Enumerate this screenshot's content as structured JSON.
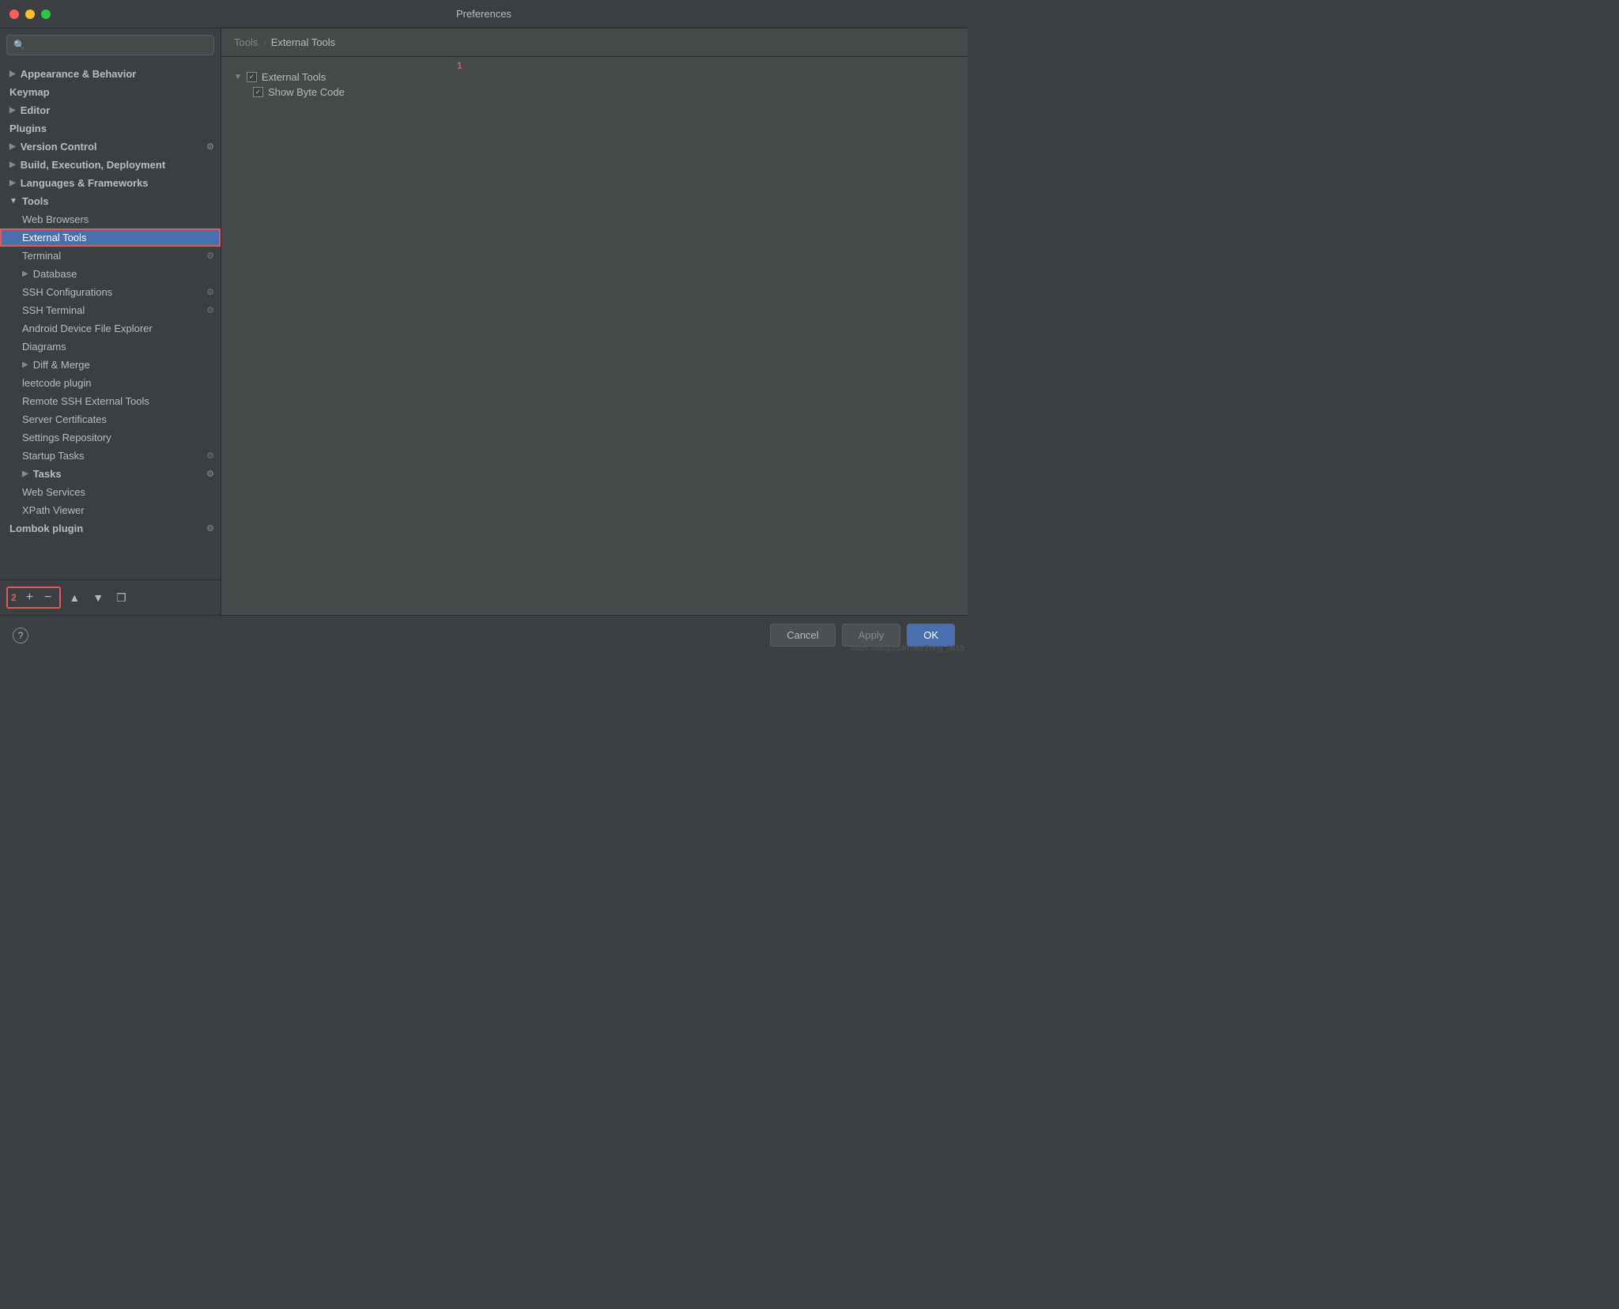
{
  "titlebar": {
    "title": "Preferences"
  },
  "sidebar": {
    "search_placeholder": "🔍",
    "items": [
      {
        "id": "appearance-behavior",
        "label": "Appearance & Behavior",
        "level": 0,
        "bold": true,
        "arrow": "▶",
        "expanded": false
      },
      {
        "id": "keymap",
        "label": "Keymap",
        "level": 0,
        "bold": true
      },
      {
        "id": "editor",
        "label": "Editor",
        "level": 0,
        "bold": true,
        "arrow": "▶",
        "expanded": false
      },
      {
        "id": "plugins",
        "label": "Plugins",
        "level": 0,
        "bold": true
      },
      {
        "id": "version-control",
        "label": "Version Control",
        "level": 0,
        "bold": true,
        "arrow": "▶",
        "expanded": false,
        "has_gear": true
      },
      {
        "id": "build-exec-deploy",
        "label": "Build, Execution, Deployment",
        "level": 0,
        "bold": true,
        "arrow": "▶",
        "expanded": false
      },
      {
        "id": "languages-frameworks",
        "label": "Languages & Frameworks",
        "level": 0,
        "bold": true,
        "arrow": "▶",
        "expanded": false
      },
      {
        "id": "tools",
        "label": "Tools",
        "level": 0,
        "bold": true,
        "arrow": "▼",
        "expanded": true
      },
      {
        "id": "web-browsers",
        "label": "Web Browsers",
        "level": 1
      },
      {
        "id": "external-tools",
        "label": "External Tools",
        "level": 1,
        "selected": true
      },
      {
        "id": "terminal",
        "label": "Terminal",
        "level": 1,
        "has_gear": true
      },
      {
        "id": "database",
        "label": "Database",
        "level": 1,
        "arrow": "▶",
        "expanded": false
      },
      {
        "id": "ssh-configurations",
        "label": "SSH Configurations",
        "level": 1,
        "has_gear": true
      },
      {
        "id": "ssh-terminal",
        "label": "SSH Terminal",
        "level": 1,
        "has_gear": true
      },
      {
        "id": "android-device",
        "label": "Android Device File Explorer",
        "level": 1
      },
      {
        "id": "diagrams",
        "label": "Diagrams",
        "level": 1
      },
      {
        "id": "diff-merge",
        "label": "Diff & Merge",
        "level": 1,
        "arrow": "▶",
        "expanded": false
      },
      {
        "id": "leetcode-plugin",
        "label": "leetcode plugin",
        "level": 1
      },
      {
        "id": "remote-ssh",
        "label": "Remote SSH External Tools",
        "level": 1
      },
      {
        "id": "server-certificates",
        "label": "Server Certificates",
        "level": 1
      },
      {
        "id": "settings-repository",
        "label": "Settings Repository",
        "level": 1
      },
      {
        "id": "startup-tasks",
        "label": "Startup Tasks",
        "level": 1,
        "has_gear": true
      },
      {
        "id": "tasks",
        "label": "Tasks",
        "level": 1,
        "bold": true,
        "arrow": "▶",
        "expanded": false,
        "has_gear": true
      },
      {
        "id": "web-services",
        "label": "Web Services",
        "level": 1
      },
      {
        "id": "xpath-viewer",
        "label": "XPath Viewer",
        "level": 1
      },
      {
        "id": "lombok-plugin",
        "label": "Lombok plugin",
        "level": 0,
        "bold": true,
        "has_gear": true
      }
    ],
    "toolbar": {
      "number_label": "2",
      "add_label": "+",
      "remove_label": "−",
      "up_label": "▲",
      "down_label": "▼",
      "copy_label": "❐"
    }
  },
  "breadcrumb": {
    "parent": "Tools",
    "separator": "›",
    "current": "External Tools"
  },
  "panel": {
    "number_label": "1",
    "tree": [
      {
        "id": "external-tools-group",
        "label": "External Tools",
        "arrow": "▼",
        "checked": true,
        "level": 0,
        "children": [
          {
            "id": "show-byte-code",
            "label": "Show Byte Code",
            "checked": true,
            "level": 1
          }
        ]
      }
    ]
  },
  "footer": {
    "help_label": "?",
    "cancel_label": "Cancel",
    "apply_label": "Apply",
    "ok_label": "OK"
  },
  "url": "https://blog.csdn.net/Zong_0915"
}
